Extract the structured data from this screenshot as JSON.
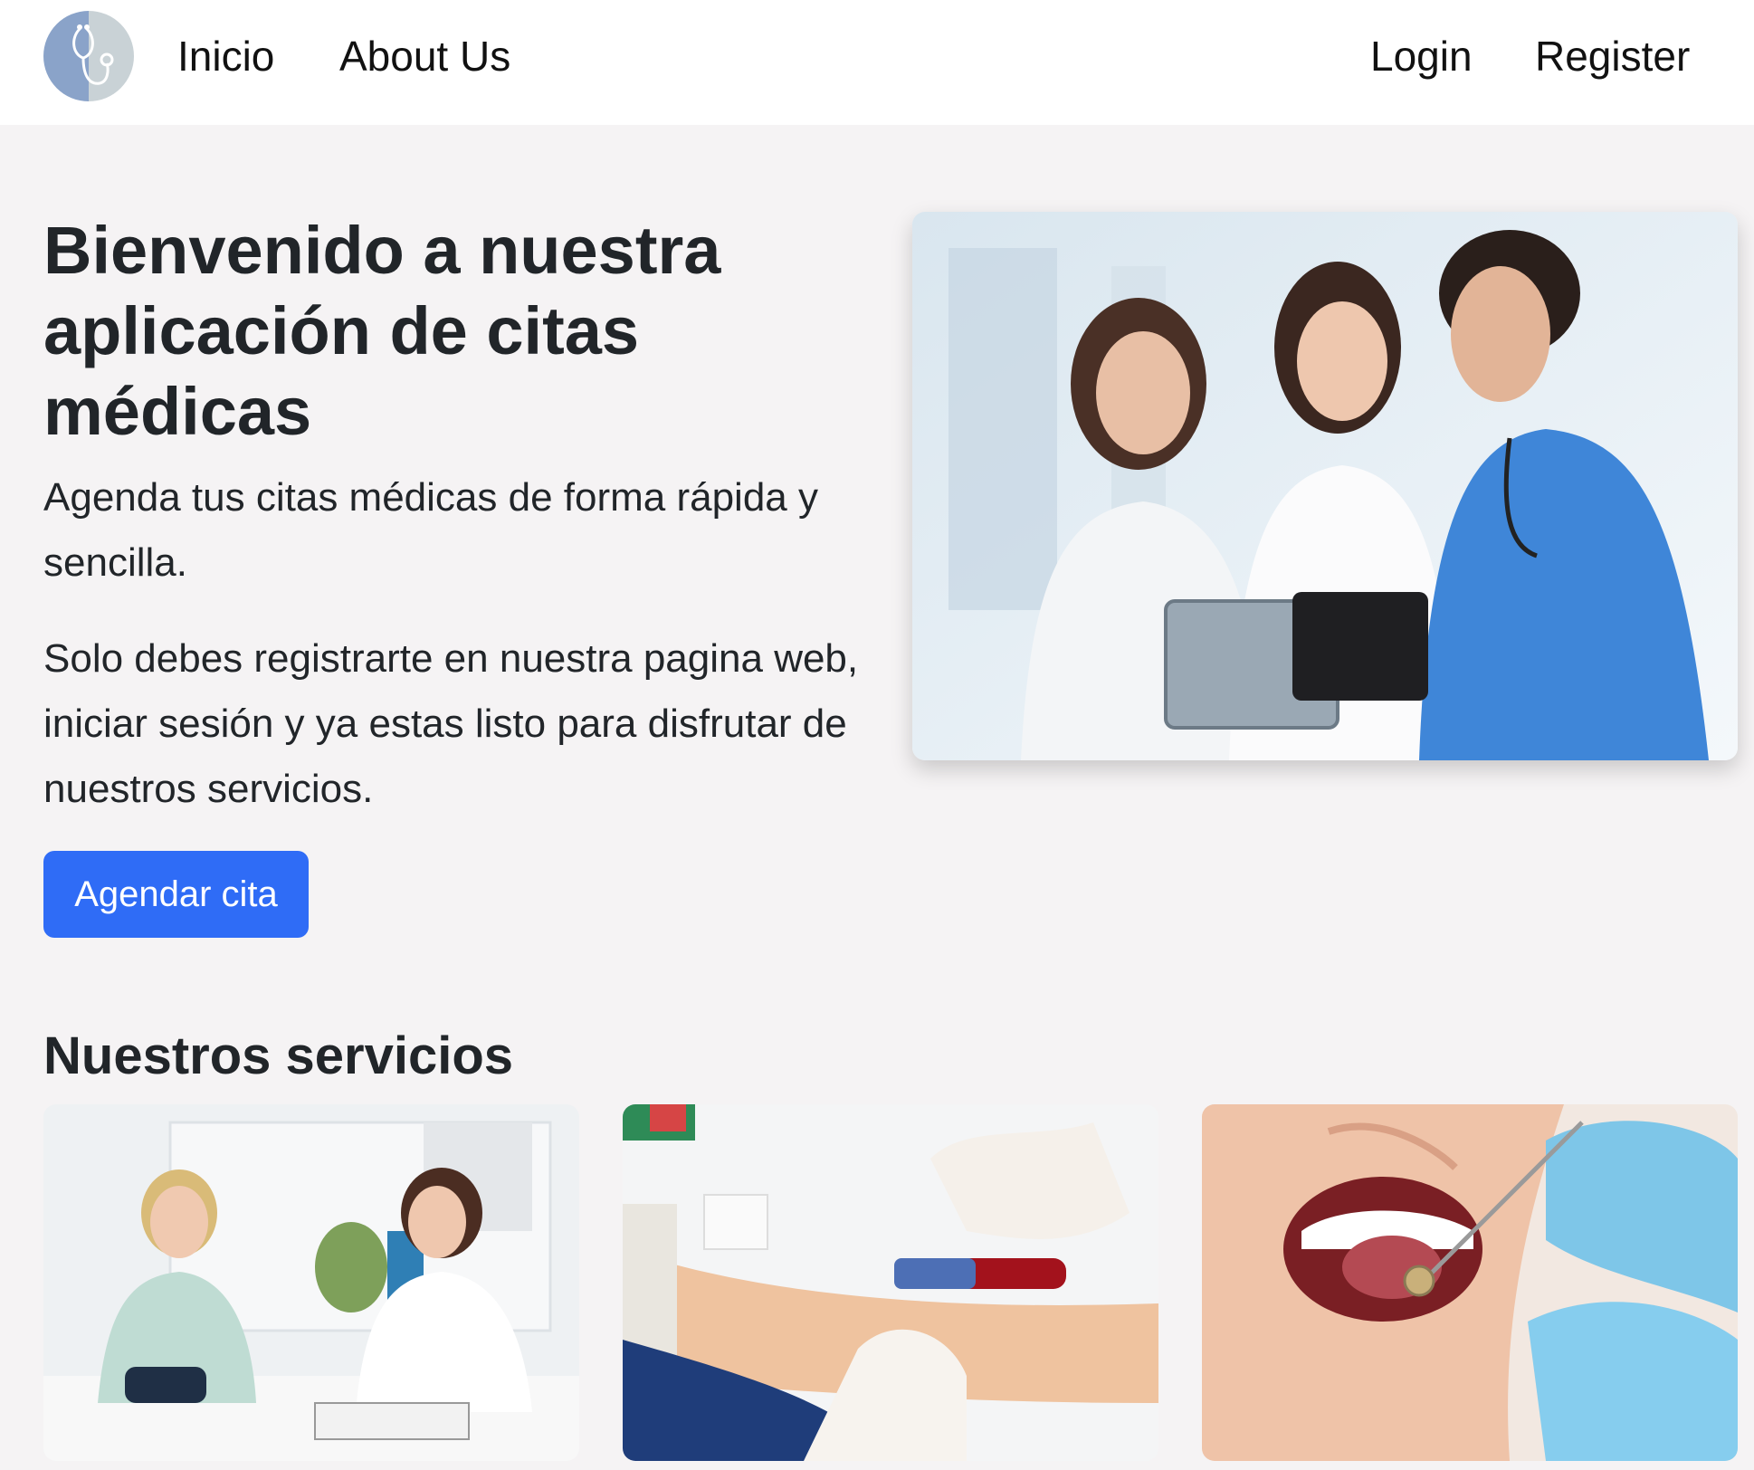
{
  "navbar": {
    "logo_icon": "stethoscope-icon",
    "links": [
      {
        "label": "Inicio"
      },
      {
        "label": "About Us"
      }
    ],
    "auth": {
      "login_label": "Login",
      "register_label": "Register"
    }
  },
  "hero": {
    "title": "Bienvenido a nuestra aplicación de citas médicas",
    "lead": "Agenda tus citas médicas de forma rápida y sencilla.",
    "description": "Solo debes registrarte en nuestra pagina web, iniciar sesión y ya estas listo para disfrutar de nuestros servicios.",
    "cta_label": "Agendar cita"
  },
  "services": {
    "title": "Nuestros servicios"
  },
  "colors": {
    "accent": "#2f6cf6",
    "background": "#f5f3f4",
    "navbar": "#ffffff"
  }
}
